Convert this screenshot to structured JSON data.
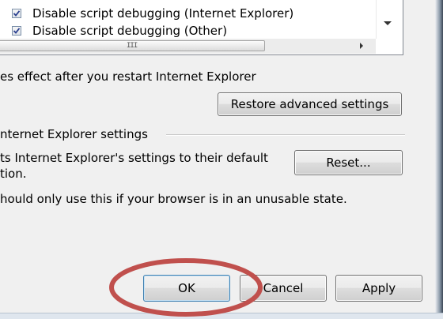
{
  "list": {
    "items": [
      {
        "label": "Disable script debugging (Internet Explorer)",
        "checked": true
      },
      {
        "label": "Disable script debugging (Other)",
        "checked": true
      }
    ],
    "hscroll_grip": "III"
  },
  "restart_note": "es effect after you restart Internet Explorer",
  "restore_button": "Restore advanced settings",
  "reset_group": {
    "title": "nternet Explorer settings",
    "desc_line1": "ts Internet Explorer's settings to their default",
    "desc_line2": "tion.",
    "reset_button": "Reset...",
    "warning": "hould only use this if your browser is in an unusable state."
  },
  "dialog_buttons": {
    "ok": "OK",
    "cancel": "Cancel",
    "apply": "Apply"
  },
  "annotation": {
    "highlight_color": "#c0504d"
  }
}
